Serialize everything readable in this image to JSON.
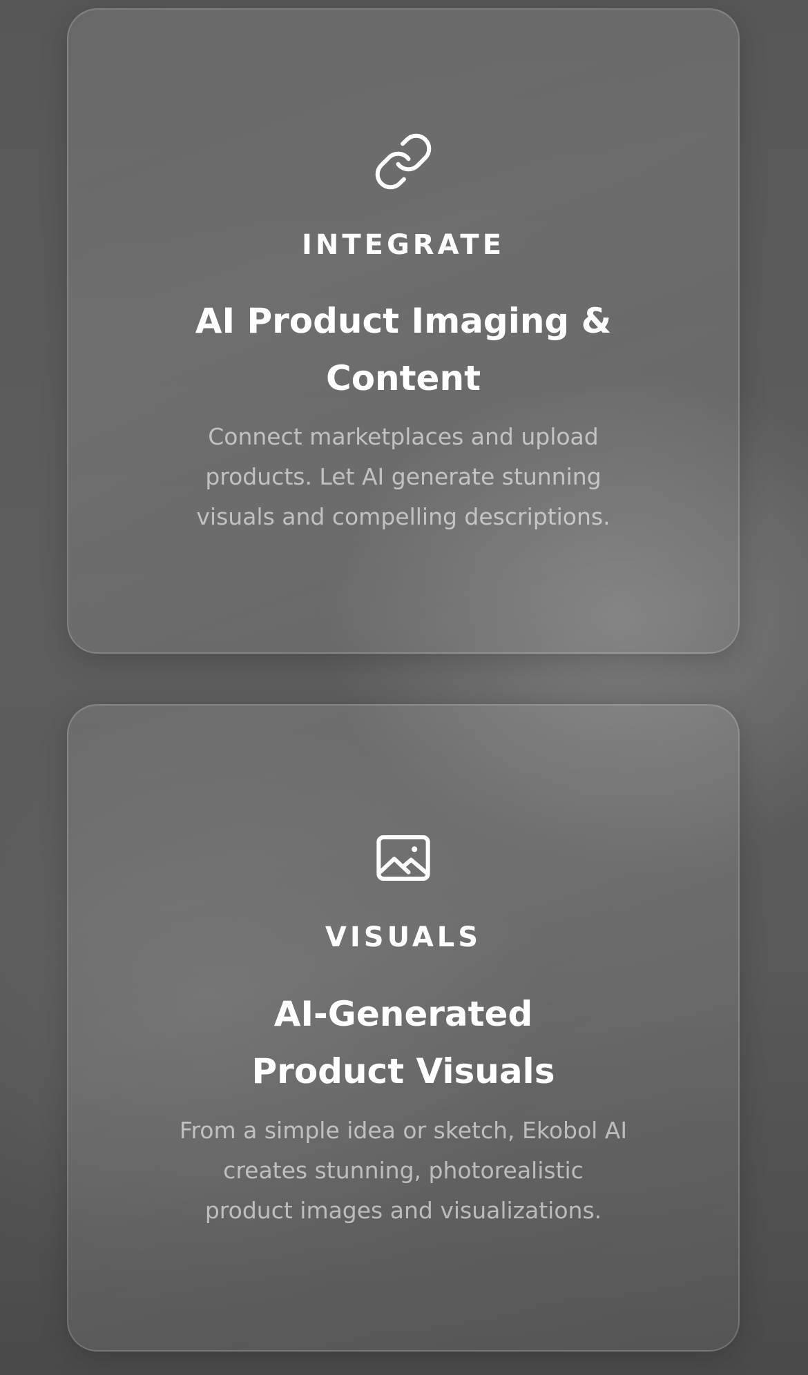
{
  "cards": [
    {
      "icon": "link-icon",
      "eyebrow": "INTEGRATE",
      "title": "AI Product Imaging & Content",
      "description": "Connect marketplaces and upload products. Let AI generate stunning visuals and compelling descriptions."
    },
    {
      "icon": "image-icon",
      "eyebrow": "VISUALS",
      "title": "AI-Generated Product Visuals",
      "description": "From a simple idea or sketch, Ekobol AI creates stunning, photorealistic product images and visualizations."
    }
  ],
  "colors": {
    "text_primary": "#ffffff",
    "text_secondary": "rgba(255,255,255,0.58)",
    "background": "#575757"
  }
}
